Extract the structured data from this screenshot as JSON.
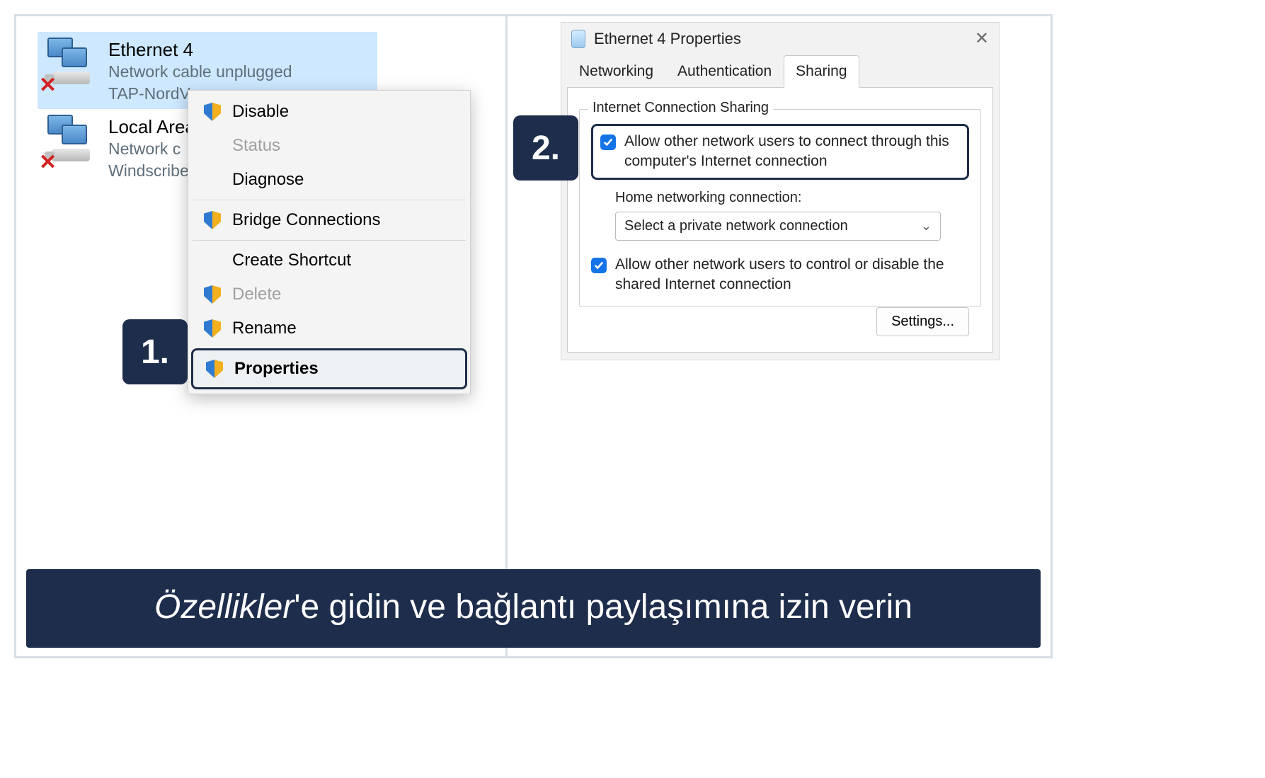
{
  "step_badges": {
    "one": "1.",
    "two": "2."
  },
  "connections": [
    {
      "title": "Ethernet 4",
      "status": "Network cable unplugged",
      "adapter": "TAP-NordV"
    },
    {
      "title": "Local Area",
      "status": "Network c",
      "adapter": "Windscribe"
    }
  ],
  "context_menu": {
    "disable": "Disable",
    "status": "Status",
    "diagnose": "Diagnose",
    "bridge": "Bridge Connections",
    "shortcut": "Create Shortcut",
    "delete": "Delete",
    "rename": "Rename",
    "properties": "Properties"
  },
  "properties_window": {
    "title": "Ethernet 4 Properties",
    "tabs": {
      "networking": "Networking",
      "authentication": "Authentication",
      "sharing": "Sharing"
    },
    "group_title": "Internet Connection Sharing",
    "allow_connect": "Allow other network users to connect through this computer's Internet connection",
    "home_label": "Home networking connection:",
    "dropdown_value": "Select a private network connection",
    "allow_control": "Allow other network users to control or disable the shared Internet connection",
    "settings_btn": "Settings..."
  },
  "caption": {
    "italic": "Özellikler",
    "rest": "'e gidin ve bağlantı paylaşımına izin verin"
  }
}
